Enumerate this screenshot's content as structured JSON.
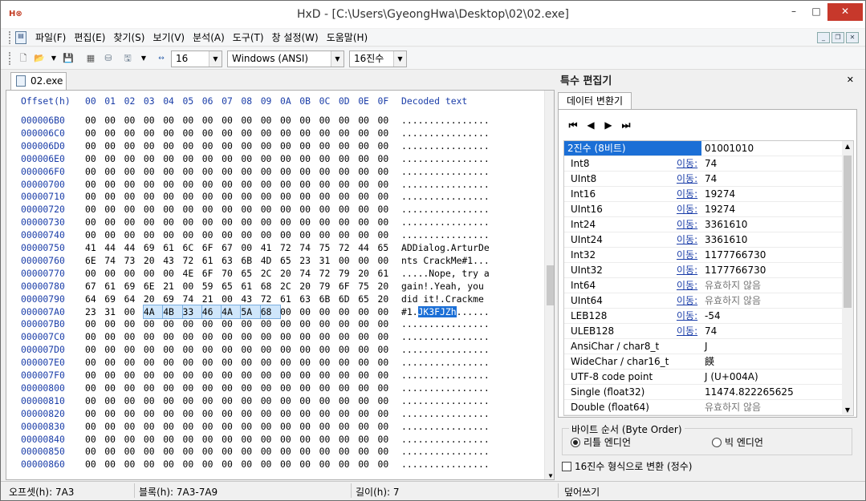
{
  "window": {
    "title": "HxD - [C:\\Users\\GyeongHwa\\Desktop\\02\\02.exe]",
    "min": "–",
    "max": "□",
    "close": "✕"
  },
  "menu": [
    "파일(F)",
    "편집(E)",
    "찾기(S)",
    "보기(V)",
    "분석(A)",
    "도구(T)",
    "창 설정(W)",
    "도움말(H)"
  ],
  "toolbar": {
    "bytes_per_row": "16",
    "charset": "Windows (ANSI)",
    "offset_base": "16진수"
  },
  "tab": {
    "label": "02.exe"
  },
  "hex": {
    "offset_header": "Offset(h)",
    "columns": [
      "00",
      "01",
      "02",
      "03",
      "04",
      "05",
      "06",
      "07",
      "08",
      "09",
      "0A",
      "0B",
      "0C",
      "0D",
      "0E",
      "0F"
    ],
    "decoded_header": "Decoded text",
    "rows": [
      {
        "off": "000006B0",
        "bytes": "00 00 00 00 00 00 00 00 00 00 00 00 00 00 00 00",
        "text": "................"
      },
      {
        "off": "000006C0",
        "bytes": "00 00 00 00 00 00 00 00 00 00 00 00 00 00 00 00",
        "text": "................"
      },
      {
        "off": "000006D0",
        "bytes": "00 00 00 00 00 00 00 00 00 00 00 00 00 00 00 00",
        "text": "................"
      },
      {
        "off": "000006E0",
        "bytes": "00 00 00 00 00 00 00 00 00 00 00 00 00 00 00 00",
        "text": "................"
      },
      {
        "off": "000006F0",
        "bytes": "00 00 00 00 00 00 00 00 00 00 00 00 00 00 00 00",
        "text": "................"
      },
      {
        "off": "00000700",
        "bytes": "00 00 00 00 00 00 00 00 00 00 00 00 00 00 00 00",
        "text": "................"
      },
      {
        "off": "00000710",
        "bytes": "00 00 00 00 00 00 00 00 00 00 00 00 00 00 00 00",
        "text": "................"
      },
      {
        "off": "00000720",
        "bytes": "00 00 00 00 00 00 00 00 00 00 00 00 00 00 00 00",
        "text": "................"
      },
      {
        "off": "00000730",
        "bytes": "00 00 00 00 00 00 00 00 00 00 00 00 00 00 00 00",
        "text": "................"
      },
      {
        "off": "00000740",
        "bytes": "00 00 00 00 00 00 00 00 00 00 00 00 00 00 00 00",
        "text": "................"
      },
      {
        "off": "00000750",
        "bytes": "41 44 44 69 61 6C 6F 67 00 41 72 74 75 72 44 65",
        "text": "ADDialog.ArturDe"
      },
      {
        "off": "00000760",
        "bytes": "6E 74 73 20 43 72 61 63 6B 4D 65 23 31 00 00 00",
        "text": "nts CrackMe#1..."
      },
      {
        "off": "00000770",
        "bytes": "00 00 00 00 00 4E 6F 70 65 2C 20 74 72 79 20 61",
        "text": ".....Nope, try a"
      },
      {
        "off": "00000780",
        "bytes": "67 61 69 6E 21 00 59 65 61 68 2C 20 79 6F 75 20",
        "text": "gain!.Yeah, you "
      },
      {
        "off": "00000790",
        "bytes": "64 69 64 20 69 74 21 00 43 72 61 63 6B 6D 65 20",
        "text": "did it!.Crackme "
      },
      {
        "off": "000007A0",
        "bytes": "23 31 00 4A 4B 33 46 4A 5A 68 00 00 00 00 00 00",
        "text": "#1.JK3FJZh......"
      },
      {
        "off": "000007B0",
        "bytes": "00 00 00 00 00 00 00 00 00 00 00 00 00 00 00 00",
        "text": "................"
      },
      {
        "off": "000007C0",
        "bytes": "00 00 00 00 00 00 00 00 00 00 00 00 00 00 00 00",
        "text": "................"
      },
      {
        "off": "000007D0",
        "bytes": "00 00 00 00 00 00 00 00 00 00 00 00 00 00 00 00",
        "text": "................"
      },
      {
        "off": "000007E0",
        "bytes": "00 00 00 00 00 00 00 00 00 00 00 00 00 00 00 00",
        "text": "................"
      },
      {
        "off": "000007F0",
        "bytes": "00 00 00 00 00 00 00 00 00 00 00 00 00 00 00 00",
        "text": "................"
      },
      {
        "off": "00000800",
        "bytes": "00 00 00 00 00 00 00 00 00 00 00 00 00 00 00 00",
        "text": "................"
      },
      {
        "off": "00000810",
        "bytes": "00 00 00 00 00 00 00 00 00 00 00 00 00 00 00 00",
        "text": "................"
      },
      {
        "off": "00000820",
        "bytes": "00 00 00 00 00 00 00 00 00 00 00 00 00 00 00 00",
        "text": "................"
      },
      {
        "off": "00000830",
        "bytes": "00 00 00 00 00 00 00 00 00 00 00 00 00 00 00 00",
        "text": "................"
      },
      {
        "off": "00000840",
        "bytes": "00 00 00 00 00 00 00 00 00 00 00 00 00 00 00 00",
        "text": "................"
      },
      {
        "off": "00000850",
        "bytes": "00 00 00 00 00 00 00 00 00 00 00 00 00 00 00 00",
        "text": "................"
      },
      {
        "off": "00000860",
        "bytes": "00 00 00 00 00 00 00 00 00 00 00 00 00 00 00 00",
        "text": "................"
      }
    ],
    "selection": {
      "row": "000007A0",
      "from": 3,
      "to": 9
    }
  },
  "panel": {
    "title": "특수 편집기",
    "close": "✕",
    "tab": "데이터 변환기",
    "rows": [
      {
        "name": "2진수 (8비트)",
        "goto": "",
        "value": "01001010"
      },
      {
        "name": "Int8",
        "goto": "이동:",
        "value": "74"
      },
      {
        "name": "UInt8",
        "goto": "이동:",
        "value": "74"
      },
      {
        "name": "Int16",
        "goto": "이동:",
        "value": "19274"
      },
      {
        "name": "UInt16",
        "goto": "이동:",
        "value": "19274"
      },
      {
        "name": "Int24",
        "goto": "이동:",
        "value": "3361610"
      },
      {
        "name": "UInt24",
        "goto": "이동:",
        "value": "3361610"
      },
      {
        "name": "Int32",
        "goto": "이동:",
        "value": "1177766730"
      },
      {
        "name": "UInt32",
        "goto": "이동:",
        "value": "1177766730"
      },
      {
        "name": "Int64",
        "goto": "이동:",
        "value": "유효하지 않음"
      },
      {
        "name": "UInt64",
        "goto": "이동:",
        "value": "유효하지 않음"
      },
      {
        "name": "LEB128",
        "goto": "이동:",
        "value": "-54"
      },
      {
        "name": "ULEB128",
        "goto": "이동:",
        "value": "74"
      },
      {
        "name": "AnsiChar / char8_t",
        "goto": "",
        "value": "J"
      },
      {
        "name": "WideChar / char16_t",
        "goto": "",
        "value": "䭊"
      },
      {
        "name": "UTF-8 code point",
        "goto": "",
        "value": "J (U+004A)"
      },
      {
        "name": "Single (float32)",
        "goto": "",
        "value": "11474.822265625"
      },
      {
        "name": "Double (float64)",
        "goto": "",
        "value": "유효하지 않음"
      }
    ],
    "byte_order_label": "바이트 순서 (Byte Order)",
    "little_endian": "리틀 엔디언",
    "big_endian": "빅 엔디언",
    "hex_check": "16진수 형식으로 변환 (정수)"
  },
  "status": {
    "offset": "오프셋(h): 7A3",
    "block": "블록(h): 7A3-7A9",
    "length": "길이(h): 7",
    "mode": "덮어쓰기"
  }
}
